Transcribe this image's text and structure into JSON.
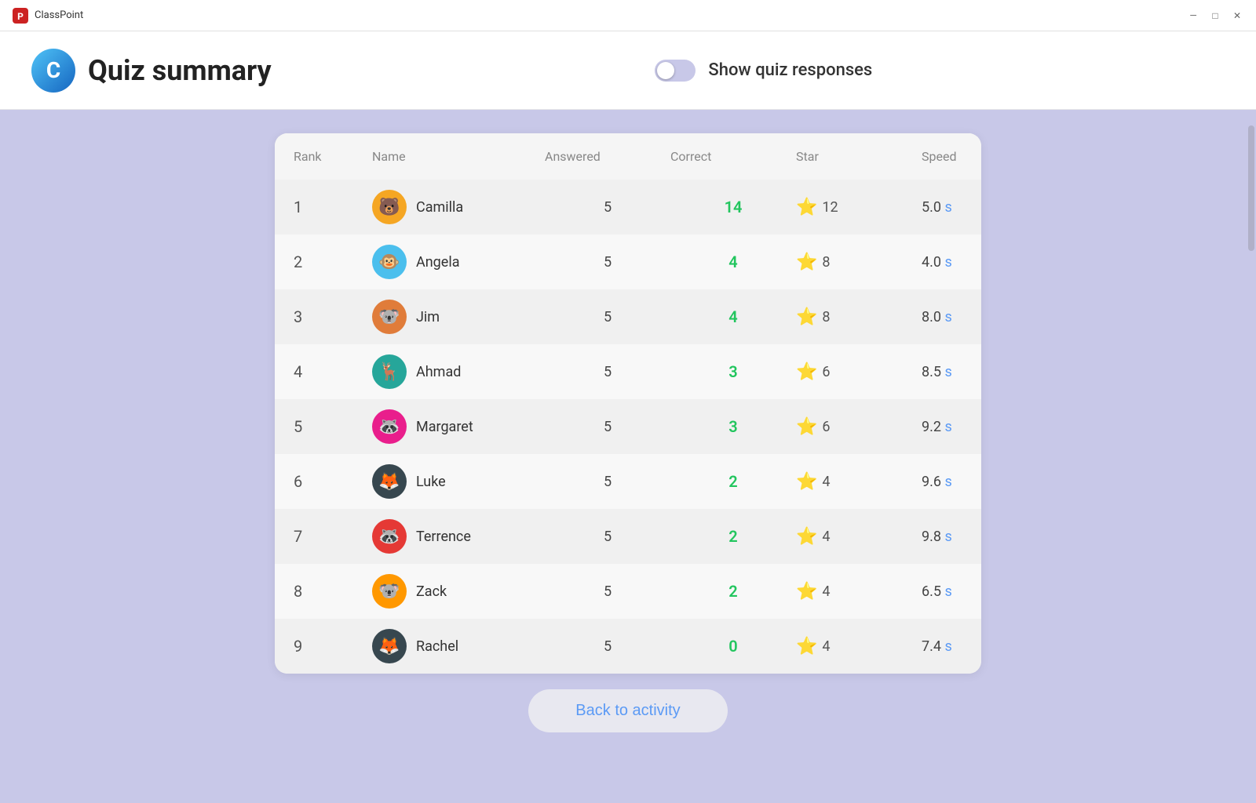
{
  "titleBar": {
    "appName": "ClassPoint",
    "appIcon": "🖥"
  },
  "header": {
    "logoText": "C",
    "title": "Quiz summary",
    "toggleLabel": "Show quiz responses",
    "toggleEnabled": false
  },
  "table": {
    "columns": [
      "Rank",
      "Name",
      "Answered",
      "Correct",
      "Star",
      "Speed"
    ],
    "rows": [
      {
        "rank": 1,
        "name": "Camilla",
        "avatarEmoji": "🐻",
        "avatarBg": "#f5a623",
        "answered": 5,
        "correct": 14,
        "correctColor": "#22c55e",
        "stars": 12,
        "speed": "5.0",
        "speedUnit": "s"
      },
      {
        "rank": 2,
        "name": "Angela",
        "avatarEmoji": "🐵",
        "avatarBg": "#4fc3f7",
        "answered": 5,
        "correct": 4,
        "correctColor": "#22c55e",
        "stars": 8,
        "speed": "4.0",
        "speedUnit": "s"
      },
      {
        "rank": 3,
        "name": "Jim",
        "avatarEmoji": "🐨",
        "avatarBg": "#e67e22",
        "answered": 5,
        "correct": 4,
        "correctColor": "#22c55e",
        "stars": 8,
        "speed": "8.0",
        "speedUnit": "s"
      },
      {
        "rank": 4,
        "name": "Ahmad",
        "avatarEmoji": "🦌",
        "avatarBg": "#26a69a",
        "answered": 5,
        "correct": 3,
        "correctColor": "#22c55e",
        "stars": 6,
        "speed": "8.5",
        "speedUnit": "s"
      },
      {
        "rank": 5,
        "name": "Margaret",
        "avatarEmoji": "🦝",
        "avatarBg": "#e91e8c",
        "answered": 5,
        "correct": 3,
        "correctColor": "#22c55e",
        "stars": 6,
        "speed": "9.2",
        "speedUnit": "s"
      },
      {
        "rank": 6,
        "name": "Luke",
        "avatarEmoji": "🦊",
        "avatarBg": "#37474f",
        "answered": 5,
        "correct": 2,
        "correctColor": "#22c55e",
        "stars": 4,
        "speed": "9.6",
        "speedUnit": "s"
      },
      {
        "rank": 7,
        "name": "Terrence",
        "avatarEmoji": "🦝",
        "avatarBg": "#e53935",
        "answered": 5,
        "correct": 2,
        "correctColor": "#22c55e",
        "stars": 4,
        "speed": "9.8",
        "speedUnit": "s"
      },
      {
        "rank": 8,
        "name": "Zack",
        "avatarEmoji": "🐨",
        "avatarBg": "#ff8c00",
        "answered": 5,
        "correct": 2,
        "correctColor": "#22c55e",
        "stars": 4,
        "speed": "6.5",
        "speedUnit": "s"
      },
      {
        "rank": 9,
        "name": "Rachel",
        "avatarEmoji": "🦊",
        "avatarBg": "#37474f",
        "answered": 5,
        "correct": 0,
        "correctColor": "#22c55e",
        "stars": 4,
        "speed": "7.4",
        "speedUnit": "s"
      }
    ]
  },
  "backButton": {
    "label": "Back to activity"
  }
}
